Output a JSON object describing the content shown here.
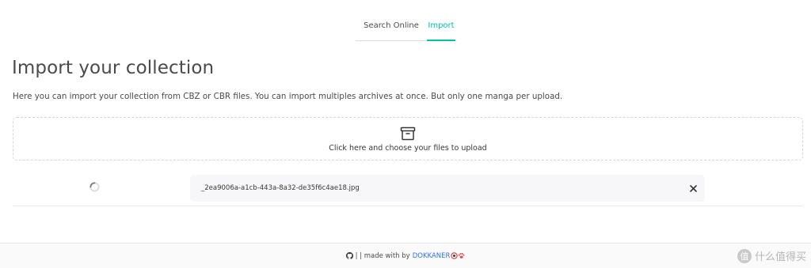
{
  "tabs": [
    {
      "label": "Search Online",
      "active": false
    },
    {
      "label": "Import",
      "active": true
    }
  ],
  "page": {
    "title": "Import your collection",
    "subtitle": "Here you can import your collection from CBZ or CBR files. You can import multiples archives at once. But only one manga per upload."
  },
  "dropzone": {
    "icon": "archive-box-icon",
    "label": "Click here and choose your files to upload"
  },
  "uploads": [
    {
      "status": "loading",
      "filename": "_2ea9006a-a1cb-443a-8a32-de35f6c4ae18.jpg"
    }
  ],
  "footer": {
    "prefix": "| | made with by",
    "brand": "DOKKANER",
    "icons": [
      "github-icon",
      "circle-logo-icon",
      "paw-icon"
    ]
  },
  "watermark": {
    "text": "什么值得买",
    "badge": "值"
  },
  "colors": {
    "accent": "#00c4a7",
    "link": "#3273dc",
    "paw": "#e0474c"
  }
}
